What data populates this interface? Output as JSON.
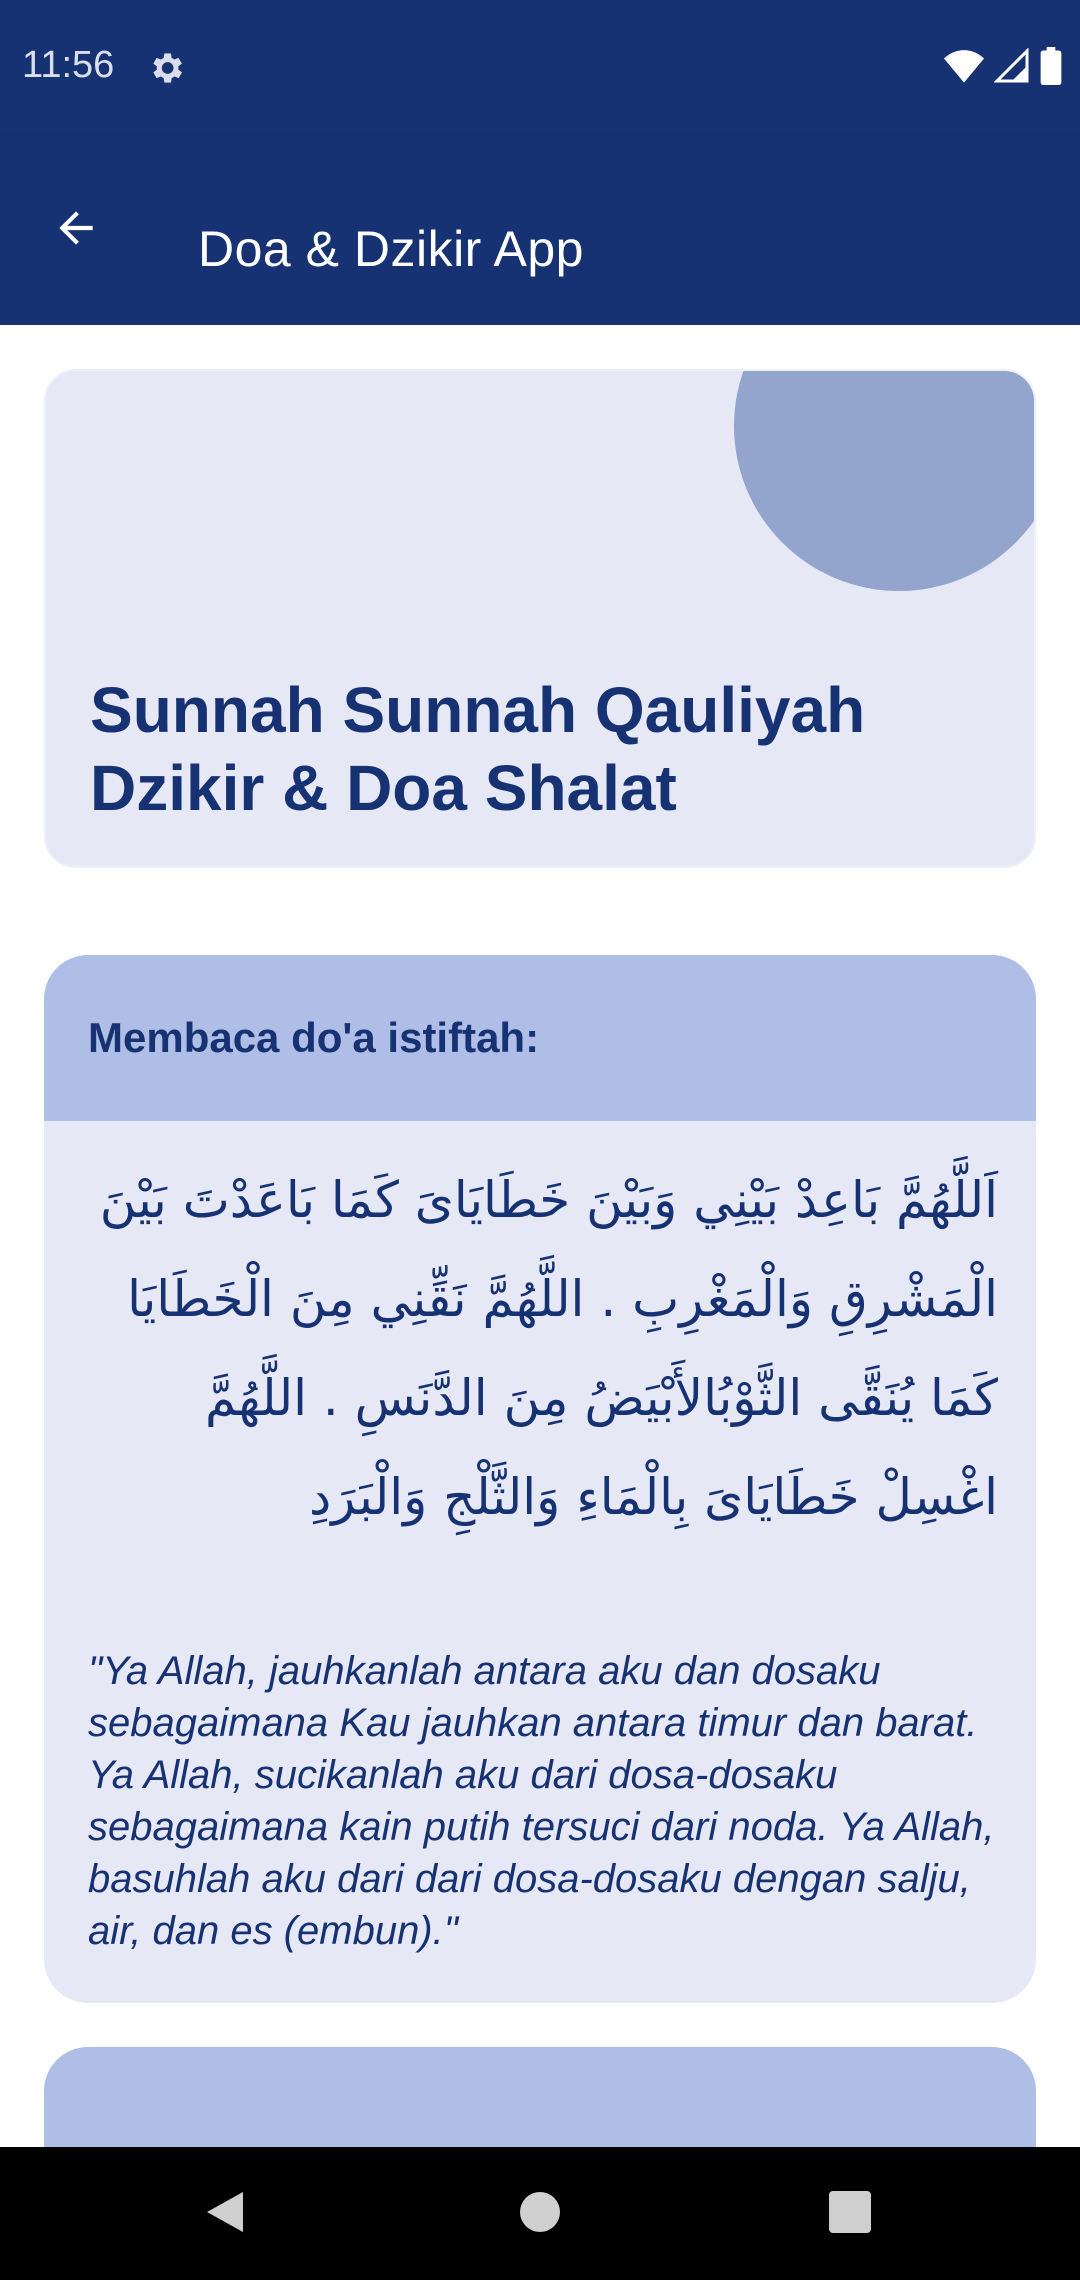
{
  "status_bar": {
    "time": "11:56",
    "icons": [
      "settings-gear-icon",
      "wifi-icon",
      "signal-icon",
      "battery-icon"
    ]
  },
  "app_bar": {
    "title": "Doa & Dzikir App",
    "back_icon": "arrow-left-icon"
  },
  "header_card": {
    "title_line1": "Sunnah Sunnah Qauliyah",
    "title_line2": "Dzikir & Doa Shalat"
  },
  "doa_card": {
    "heading": "Membaca do'a istiftah:",
    "arabic": "اَللَّهُمَّ بَاعِدْ بَيْنِي وَبَيْنَ خَطَايَاىَ كَمَا بَاعَدْتَ بَيْنَ الْمَشْرِقِ وَالْمَغْرِبِ . اللَّهُمَّ نَقِّنِي مِنَ الْخَطَايَا كَمَا يُنَقَّى الثَّوْبُالأَبْيَضُ مِنَ الدَّنَسِ . اللَّهُمَّ اغْسِلْ خَطَايَاىَ بِالْمَاءِ وَالثَّلْجِ وَالْبَرَدِ",
    "translation": "\"Ya Allah, jauhkanlah antara aku dan dosaku sebagaimana Kau jauhkan antara timur dan barat. Ya Allah, sucikanlah aku dari dosa-dosaku sebagaimana kain putih tersuci dari noda. Ya Allah, basuhlah aku dari dari dosa-dosaku dengan salju, air, dan es (embun).\""
  },
  "colors": {
    "primary": "#163273",
    "card_bg": "#e6e8f6",
    "card_header_bg": "#afbee6",
    "accent_circle": "#93a4cd"
  },
  "nav_bar": {
    "buttons": [
      "back-triangle-icon",
      "home-circle-icon",
      "recents-square-icon"
    ]
  }
}
